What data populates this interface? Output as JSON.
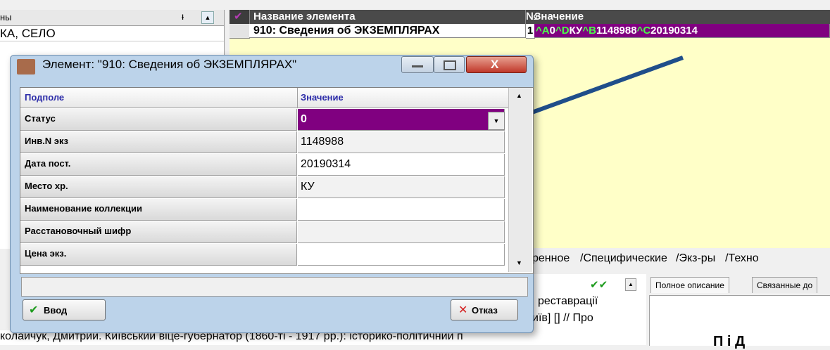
{
  "left_panel": {
    "header_label": "ны",
    "pin_icon": "pin-icon",
    "row1_text": "КА, СЕЛО"
  },
  "grid": {
    "columns": [
      "Название элемента",
      "№",
      "Значение"
    ],
    "rows": [
      {
        "name": "910: Сведения  об ЭКЗЕМПЛЯРАХ",
        "num": "1",
        "value_parts": [
          {
            "t": "^A",
            "c": "#49ff49"
          },
          {
            "t": "0",
            "c": "#ffffff"
          },
          {
            "t": "^D",
            "c": "#49ff49"
          },
          {
            "t": "КУ",
            "c": "#ffffff"
          },
          {
            "t": "^B",
            "c": "#49ff49"
          },
          {
            "t": "1148988",
            "c": "#ffffff"
          },
          {
            "t": "^C",
            "c": "#49ff49"
          },
          {
            "t": "20190314",
            "c": "#ffffff"
          }
        ]
      }
    ],
    "accent": "#800080"
  },
  "dialog": {
    "title": "Элемент: \"910: Сведения  об ЭКЗЕМПЛЯРАХ\"",
    "col_subfield": "Подполе",
    "col_value": "Значение",
    "rows": [
      {
        "name": "Статус",
        "value": "0"
      },
      {
        "name": "Инв.N экз",
        "value": "1148988"
      },
      {
        "name": "Дата пост.",
        "value": "20190314"
      },
      {
        "name": "Место хр.",
        "value": "КУ"
      },
      {
        "name": "Наименование коллекции",
        "value": ""
      },
      {
        "name": "Расстановочный шифр",
        "value": ""
      },
      {
        "name": "Цена экз.",
        "value": ""
      }
    ],
    "ok_label": "Ввод",
    "cancel_label": "Отказ"
  },
  "tabs": [
    "ренное",
    "Специфические",
    "Экз-ры",
    "Техно"
  ],
  "bottom": {
    "snippet1": "реставрації",
    "snippet2": "иїв] [] // Про",
    "footer_text": "колайчук, Дмитрий. Київський віце-губернатор (1860-ті - 1917 рр.): історико-політичний п",
    "desc_tab1": "Полное описание",
    "desc_tab2": "Связанные до",
    "desc_big": "П    і Д"
  }
}
